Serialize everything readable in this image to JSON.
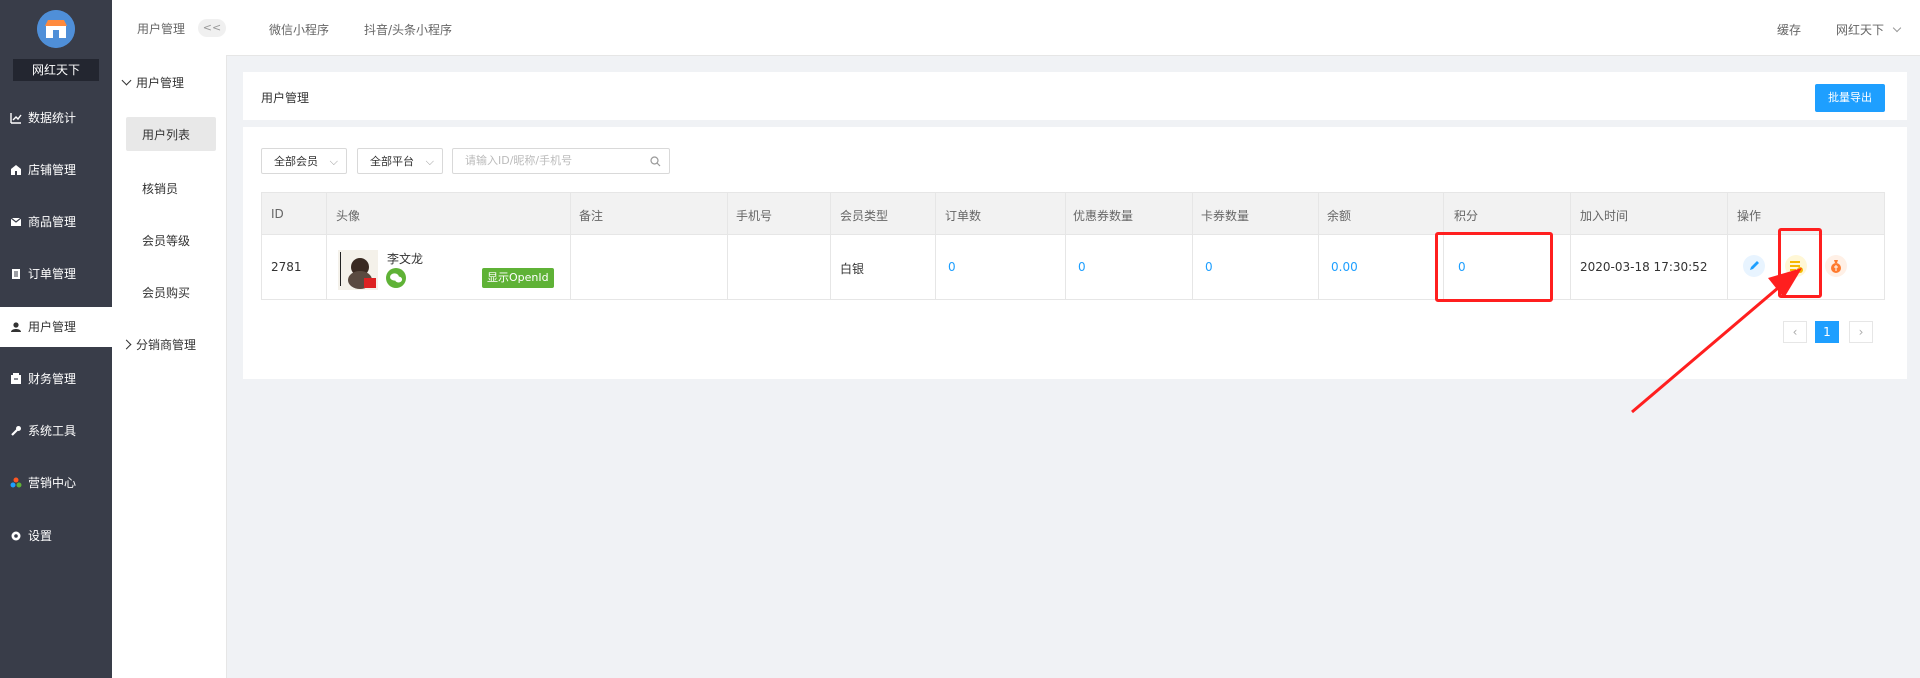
{
  "brand": {
    "name": "网红天下"
  },
  "sidebar": {
    "items": [
      {
        "label": "数据统计",
        "icon": "chart-icon"
      },
      {
        "label": "店铺管理",
        "icon": "shop-icon"
      },
      {
        "label": "商品管理",
        "icon": "goods-icon"
      },
      {
        "label": "订单管理",
        "icon": "order-icon"
      },
      {
        "label": "用户管理",
        "icon": "user-icon",
        "active": true
      },
      {
        "label": "财务管理",
        "icon": "finance-icon"
      },
      {
        "label": "系统工具",
        "icon": "wrench-icon"
      },
      {
        "label": "营销中心",
        "icon": "marketing-icon"
      },
      {
        "label": "设置",
        "icon": "gear-icon"
      }
    ]
  },
  "subnav": {
    "title": "用户管理",
    "collapse_label": "<<",
    "group": "用户管理",
    "items": [
      "用户列表",
      "核销员",
      "会员等级",
      "会员购买"
    ],
    "group2": "分销商管理"
  },
  "topbar": {
    "tabs": [
      "微信小程序",
      "抖音/头条小程序"
    ],
    "cache": "缓存",
    "user": "网红天下"
  },
  "page": {
    "title": "用户管理",
    "export_button": "批量导出"
  },
  "filters": {
    "member": "全部会员",
    "platform": "全部平台",
    "search_placeholder": "请输入ID/昵称/手机号"
  },
  "table": {
    "columns": [
      "ID",
      "头像",
      "备注",
      "手机号",
      "会员类型",
      "订单数",
      "优惠券数量",
      "卡券数量",
      "余额",
      "积分",
      "加入时间",
      "操作"
    ],
    "rows": [
      {
        "id": "2781",
        "nickname": "李文龙",
        "openid_label": "显示OpenId",
        "remark": "",
        "phone": "",
        "member_type": "白银",
        "orders": "0",
        "coupons": "0",
        "cards": "0",
        "balance": "0.00",
        "points": "0",
        "joined": "2020-03-18 17:30:52"
      }
    ]
  },
  "pagination": {
    "prev": "‹",
    "current": "1",
    "next": "›"
  },
  "colors": {
    "accent": "#1e9fff",
    "sidebar": "#393d49",
    "highlight": "#ff1f1f",
    "wechat": "#5fb236"
  }
}
